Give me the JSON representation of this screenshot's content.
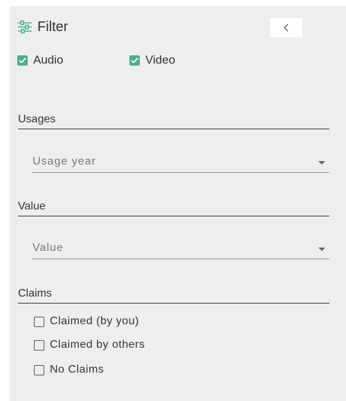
{
  "header": {
    "title": "Filter"
  },
  "media_types": [
    {
      "label": "Audio",
      "checked": true
    },
    {
      "label": "Video",
      "checked": true
    }
  ],
  "sections": {
    "usages": {
      "title": "Usages",
      "select_placeholder": "Usage year"
    },
    "value": {
      "title": "Value",
      "select_placeholder": "Value"
    },
    "claims": {
      "title": "Claims",
      "options": [
        {
          "label": "Claimed (by you)",
          "checked": false
        },
        {
          "label": "Claimed by others",
          "checked": false
        },
        {
          "label": "No Claims",
          "checked": false
        }
      ]
    }
  },
  "colors": {
    "panel_bg": "#eeeeee",
    "check_accent": "#4caf8a"
  }
}
